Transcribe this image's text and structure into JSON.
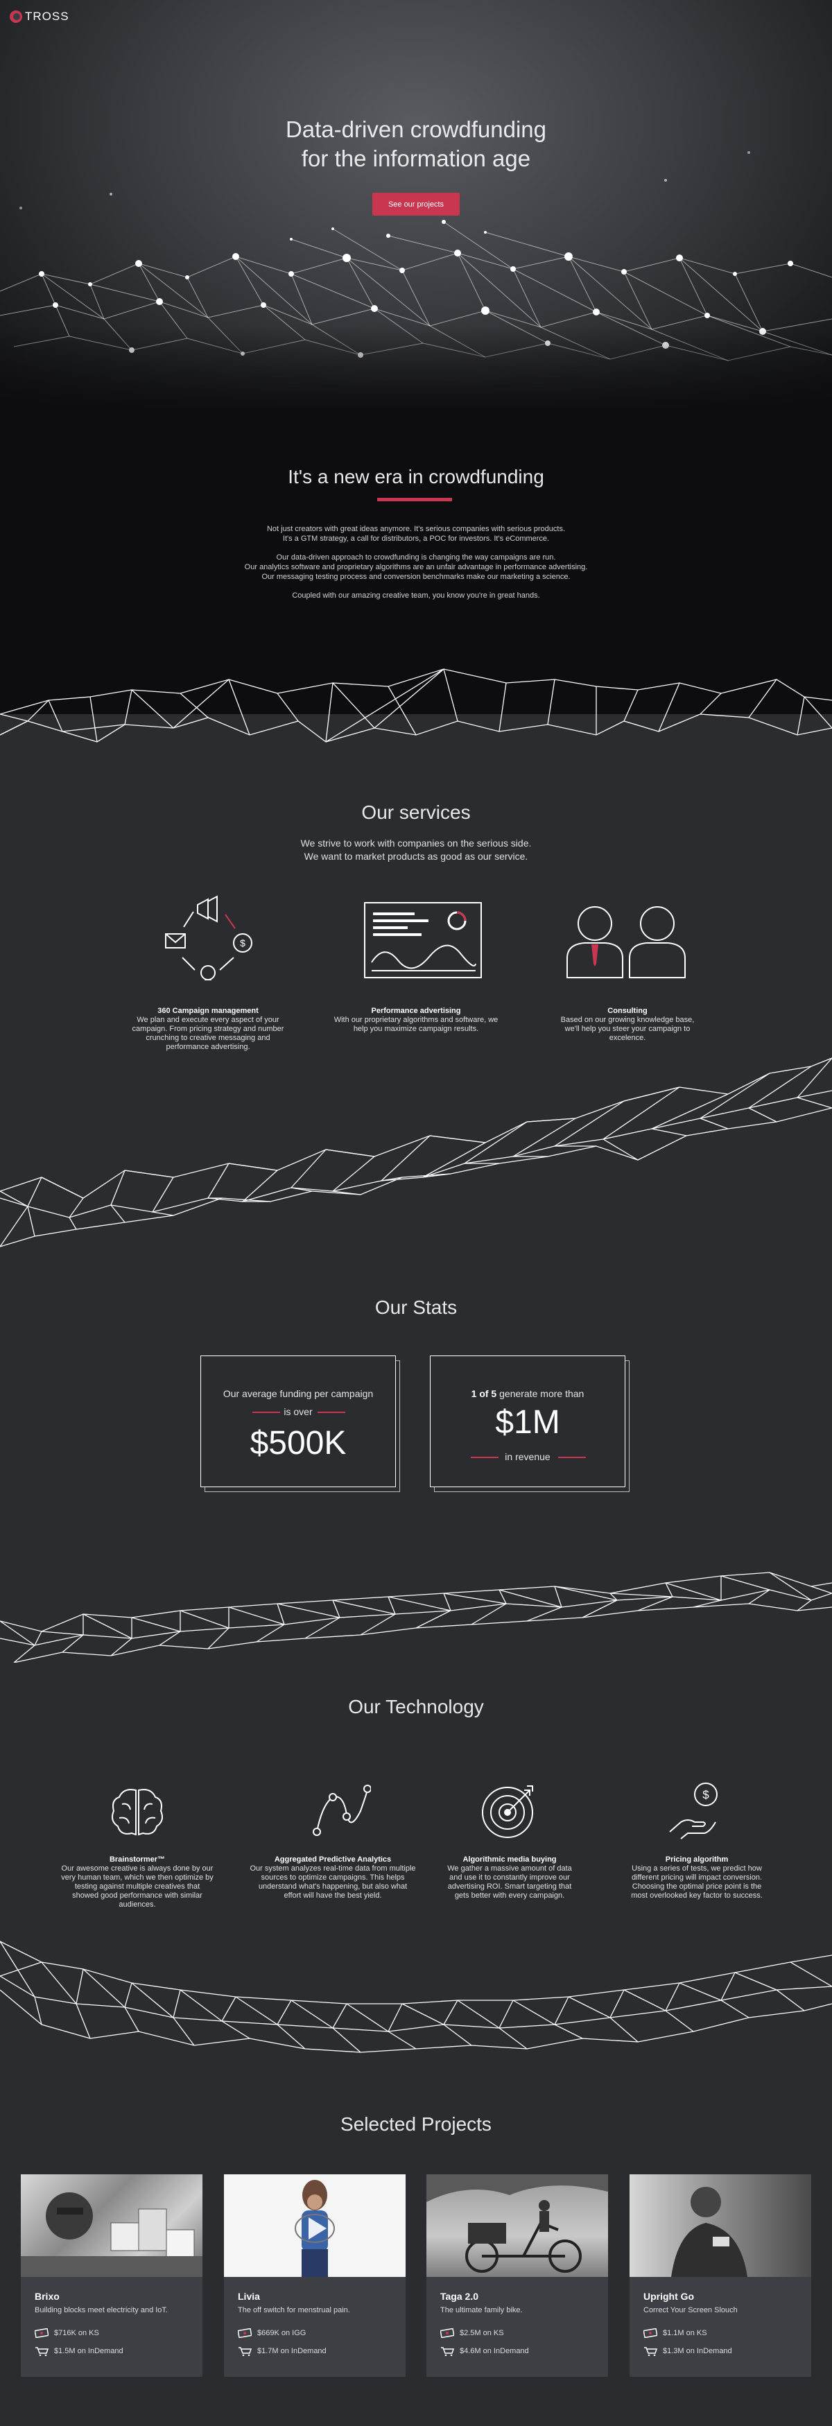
{
  "brand": {
    "logo_text": "TROSS"
  },
  "hero": {
    "title_line1": "Data-driven crowdfunding",
    "title_line2": "for the information age",
    "cta_label": "See our projects"
  },
  "era": {
    "title": "It's a new era in crowdfunding",
    "p1_line1": "Not just creators with great ideas anymore. It's serious companies with serious products.",
    "p1_line2": "It's a GTM strategy, a call for distributors, a POC for investors. It's eCommerce.",
    "p2_line1": "Our data-driven approach to crowdfunding is changing the way campaigns are run.",
    "p2_line2": "Our analytics software and proprietary algorithms are an unfair advantage in performance advertising.",
    "p2_line3": "Our messaging testing process and conversion benchmarks make our marketing a science.",
    "p3": "Coupled with our amazing creative team, you know you're in great hands."
  },
  "services": {
    "title": "Our services",
    "subtitle_line1": "We strive to work with companies on the serious side.",
    "subtitle_line2": "We want to market products as good as our service.",
    "items": [
      {
        "title": "360 Campaign management",
        "text": "We plan and execute every aspect of your campaign. From pricing strategy and number crunching to creative messaging and performance advertising.",
        "icon": "campaign-cycle-icon"
      },
      {
        "title": "Performance advertising",
        "text": "With our proprietary algorithms and software, we help you maximize campaign results.",
        "icon": "dashboard-icon"
      },
      {
        "title": "Consulting",
        "text": "Based on our growing knowledge base, we'll help you steer your campaign to excelence.",
        "icon": "consultants-icon"
      }
    ]
  },
  "stats": {
    "title": "Our Stats",
    "card1": {
      "line1": "Our average funding per campaign",
      "line2": "is over",
      "value": "$500K"
    },
    "card2": {
      "strong": "1 of 5",
      "line1_rest": " generate more than",
      "value": "$1M",
      "line2": "in revenue"
    }
  },
  "technology": {
    "title": "Our Technology",
    "items": [
      {
        "title": "Brainstormer™",
        "text": "Our awesome creative is always done by our very human team, which we then optimize by testing against multiple creatives that showed good performance with similar audiences.",
        "icon": "brain-icon"
      },
      {
        "title": "Aggregated Predictive Analytics",
        "text": "Our system analyzes real-time data from multiple sources to optimize campaigns. This helps understand what's happening, but also what effort will have the best yield.",
        "icon": "analytics-curve-icon"
      },
      {
        "title": "Algorithmic media buying",
        "text": "We gather a massive amount of data and use it to constantly improve our advertising ROI. Smart targeting that gets better with every campaign.",
        "icon": "target-icon"
      },
      {
        "title": "Pricing algorithm",
        "text": "Using a series of tests, we predict how different pricing will impact conversion. Choosing the optimal price point is the most overlooked key factor to success.",
        "icon": "pricing-hand-icon"
      }
    ]
  },
  "projects": {
    "title": "Selected Projects",
    "items": [
      {
        "name": "Brixo",
        "desc": "Building blocks meet electricity and IoT.",
        "stat1": "$716K on KS",
        "stat2": "$1.5M on InDemand"
      },
      {
        "name": "Livia",
        "desc": "The off switch for menstrual pain.",
        "stat1": "$669K on IGG",
        "stat2": "$1.7M on InDemand"
      },
      {
        "name": "Taga 2.0",
        "desc": "The ultimate family bike.",
        "stat1": "$2.5M on KS",
        "stat2": "$4.6M on InDemand"
      },
      {
        "name": "Upright Go",
        "desc": "Correct Your Screen Slouch",
        "stat1": "$1.1M on KS",
        "stat2": "$1.3M on InDemand"
      }
    ]
  }
}
